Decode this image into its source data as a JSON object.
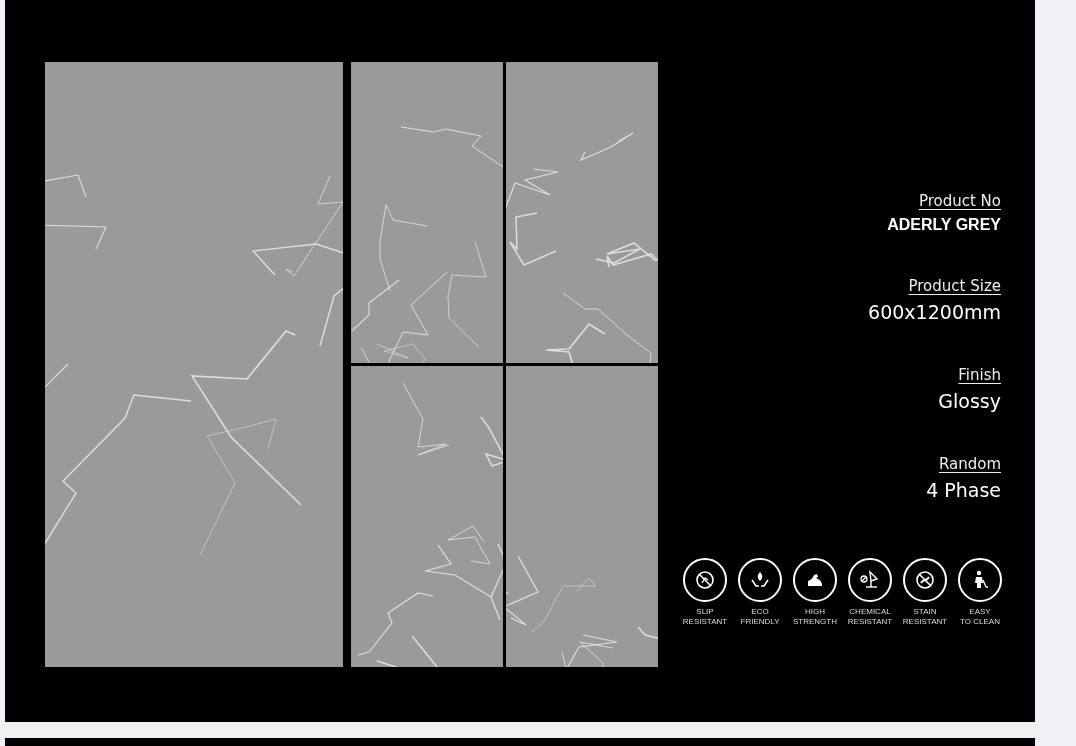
{
  "specs": [
    {
      "label": "Product No",
      "value": "ADERLY GREY",
      "kind": "bold"
    },
    {
      "label": "Product Size",
      "value": "600x1200mm",
      "kind": "plain"
    },
    {
      "label": "Finish",
      "value": "Glossy",
      "kind": "plain"
    },
    {
      "label": "Random",
      "value": "4 Phase",
      "kind": "plain"
    }
  ],
  "features": [
    {
      "lines": [
        "SLIP",
        "RESISTANT"
      ]
    },
    {
      "lines": [
        "ECO",
        "FRIENDLY"
      ]
    },
    {
      "lines": [
        "HIGH",
        "STRENGTH"
      ]
    },
    {
      "lines": [
        "CHEMICAL",
        "RESISTANT"
      ]
    },
    {
      "lines": [
        "STAIN",
        "RESISTANT"
      ]
    },
    {
      "lines": [
        "EASY",
        "TO CLEAN"
      ]
    }
  ]
}
